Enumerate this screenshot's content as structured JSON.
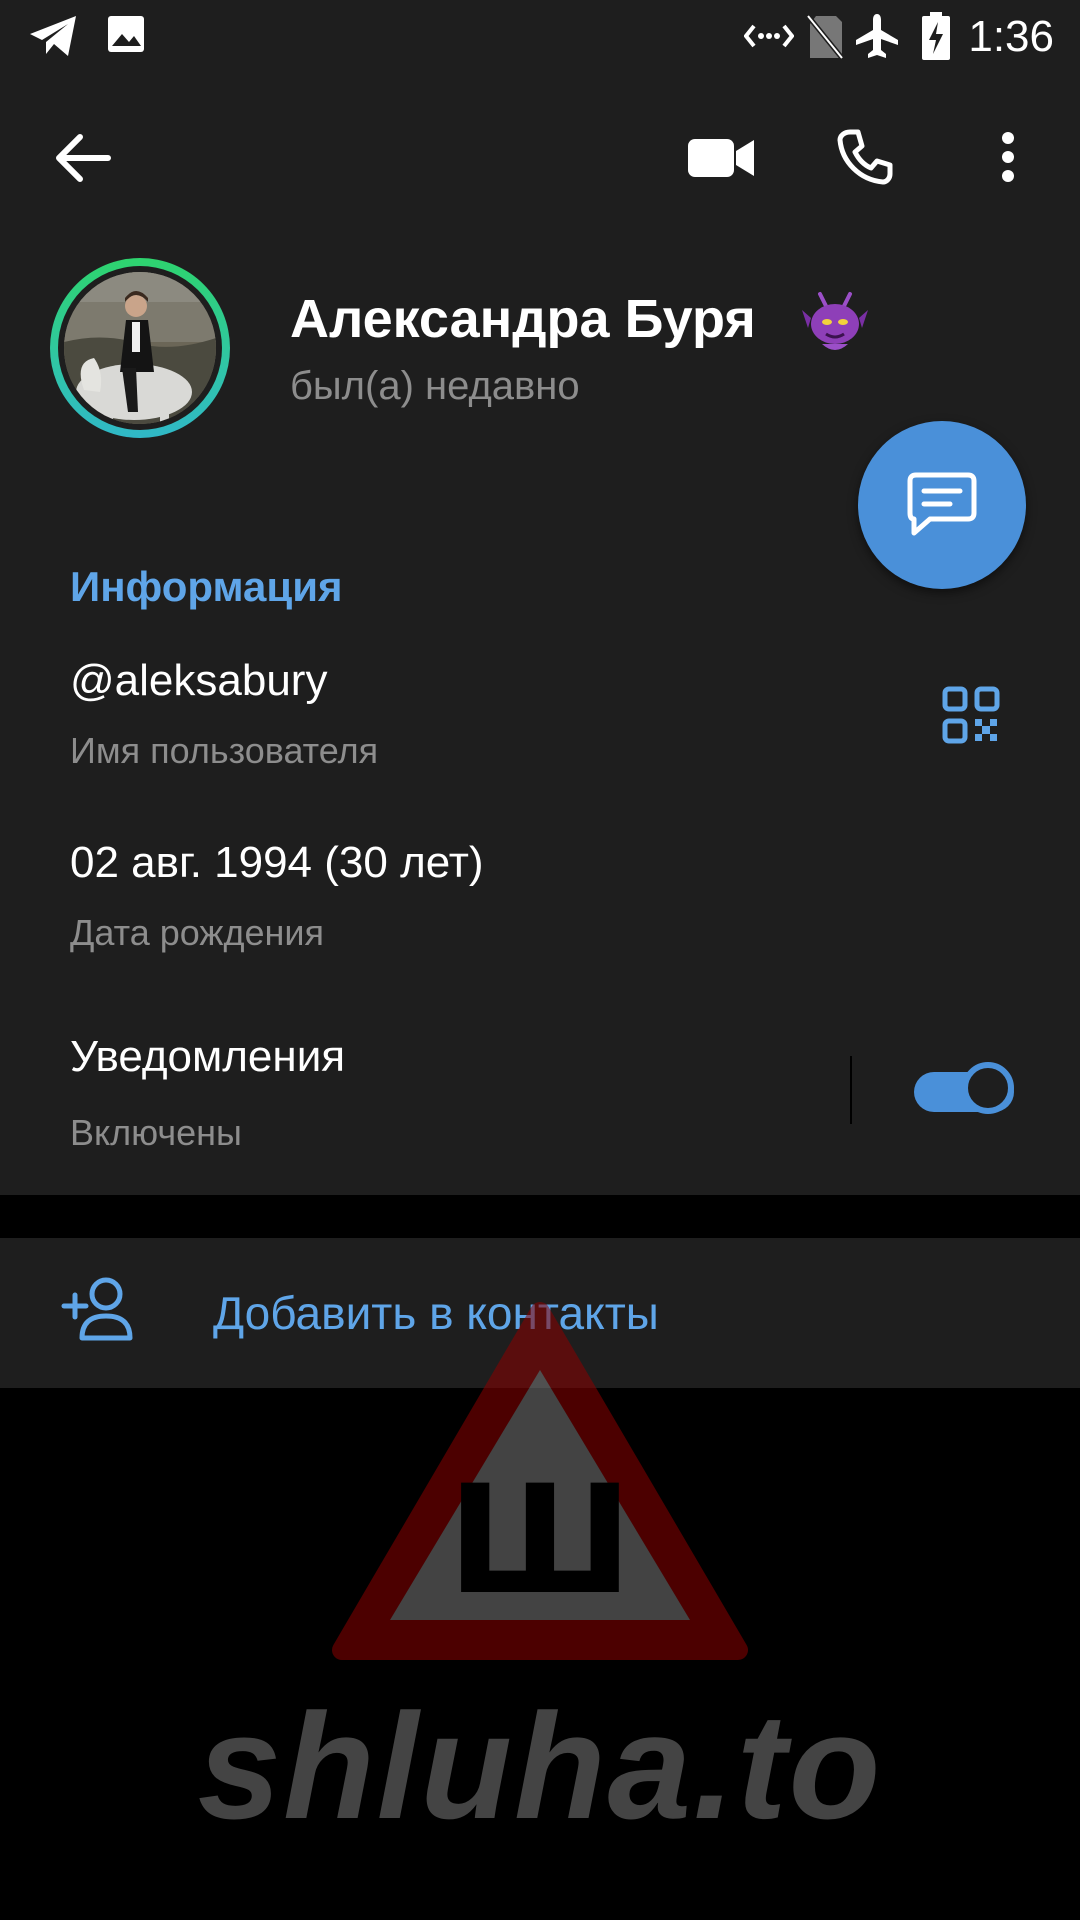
{
  "status_bar": {
    "time": "1:36"
  },
  "header": {
    "name": "Александра Буря",
    "last_seen": "был(а) недавно"
  },
  "info": {
    "section_title": "Информация",
    "username": "@aleksabury",
    "username_label": "Имя пользователя",
    "birthday": "02 авг. 1994 (30 лет)",
    "birthday_label": "Дата рождения",
    "notifications_title": "Уведомления",
    "notifications_state": "Включены",
    "notifications_enabled": true
  },
  "actions": {
    "add_contact": "Добавить в контакты"
  },
  "watermark": {
    "text": "shluha.to",
    "symbol": "Ш"
  },
  "colors": {
    "accent": "#4a90d9",
    "accent_text": "#5fa5e8",
    "background": "#1e1e1e",
    "avatar_ring": "#2ed46e"
  },
  "icons": [
    "telegram-icon",
    "image-icon",
    "data-saver-icon",
    "no-sim-icon",
    "airplane-icon",
    "battery-charging-icon",
    "back-arrow-icon",
    "video-call-icon",
    "phone-icon",
    "more-vert-icon",
    "message-icon",
    "qr-code-icon",
    "add-person-icon",
    "emoji-status-icon"
  ]
}
